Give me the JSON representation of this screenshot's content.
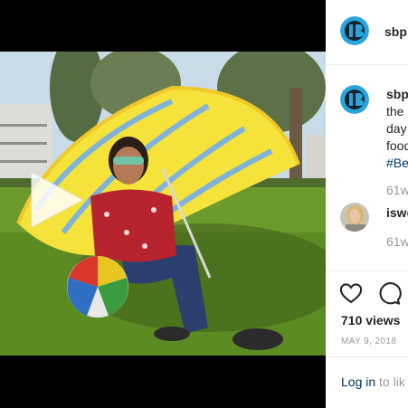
{
  "post": {
    "username": "sbp",
    "caption_lines": [
      "the",
      "day",
      "food"
    ],
    "caption_hashtag": "#Be",
    "caption_time": "61w",
    "views": "710 views",
    "date": "MAY 9, 2018"
  },
  "comment": {
    "username": "iswe",
    "time": "61w"
  },
  "login": {
    "link": "Log in",
    "rest": "to lik"
  },
  "icons": {
    "play": "play-icon",
    "heart": "heart-icon",
    "comment": "comment-icon"
  },
  "colors": {
    "link_blue": "#003569",
    "muted_gray": "#999999",
    "text_dark": "#262626",
    "avatar_blue": "#2aa5dc"
  }
}
